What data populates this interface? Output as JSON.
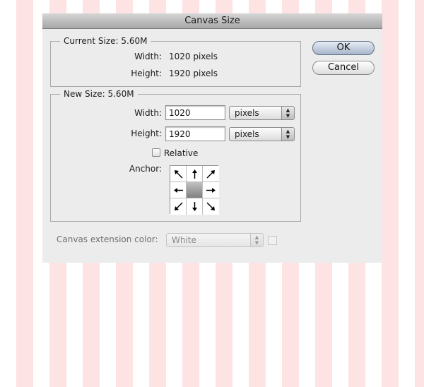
{
  "dialog": {
    "title": "Canvas Size",
    "current_size": {
      "legend": "Current Size: 5.60M",
      "width_label": "Width:",
      "width_value": "1020 pixels",
      "height_label": "Height:",
      "height_value": "1920 pixels"
    },
    "new_size": {
      "legend": "New Size: 5.60M",
      "width_label": "Width:",
      "width_value": "1020",
      "width_unit": "pixels",
      "height_label": "Height:",
      "height_value": "1920",
      "height_unit": "pixels",
      "relative_label": "Relative",
      "relative_checked": false,
      "anchor_label": "Anchor:",
      "anchor_selected": "center",
      "anchor_cells": [
        {
          "name": "anchor-top-left",
          "icon": "arrow-up-left-icon"
        },
        {
          "name": "anchor-top",
          "icon": "arrow-up-icon"
        },
        {
          "name": "anchor-top-right",
          "icon": "arrow-up-right-icon"
        },
        {
          "name": "anchor-left",
          "icon": "arrow-left-icon"
        },
        {
          "name": "anchor-center",
          "icon": "none"
        },
        {
          "name": "anchor-right",
          "icon": "arrow-right-icon"
        },
        {
          "name": "anchor-bottom-left",
          "icon": "arrow-down-left-icon"
        },
        {
          "name": "anchor-bottom",
          "icon": "arrow-down-icon"
        },
        {
          "name": "anchor-bottom-right",
          "icon": "arrow-down-right-icon"
        }
      ]
    },
    "extension": {
      "label": "Canvas extension color:",
      "value": "White"
    },
    "buttons": {
      "ok": "OK",
      "cancel": "Cancel"
    }
  },
  "colors": {
    "stripe": "#fde3e3",
    "dialog_bg": "#ececec",
    "ok_button_top": "#e6ecf5",
    "ok_button_bottom": "#a7b5c9"
  }
}
